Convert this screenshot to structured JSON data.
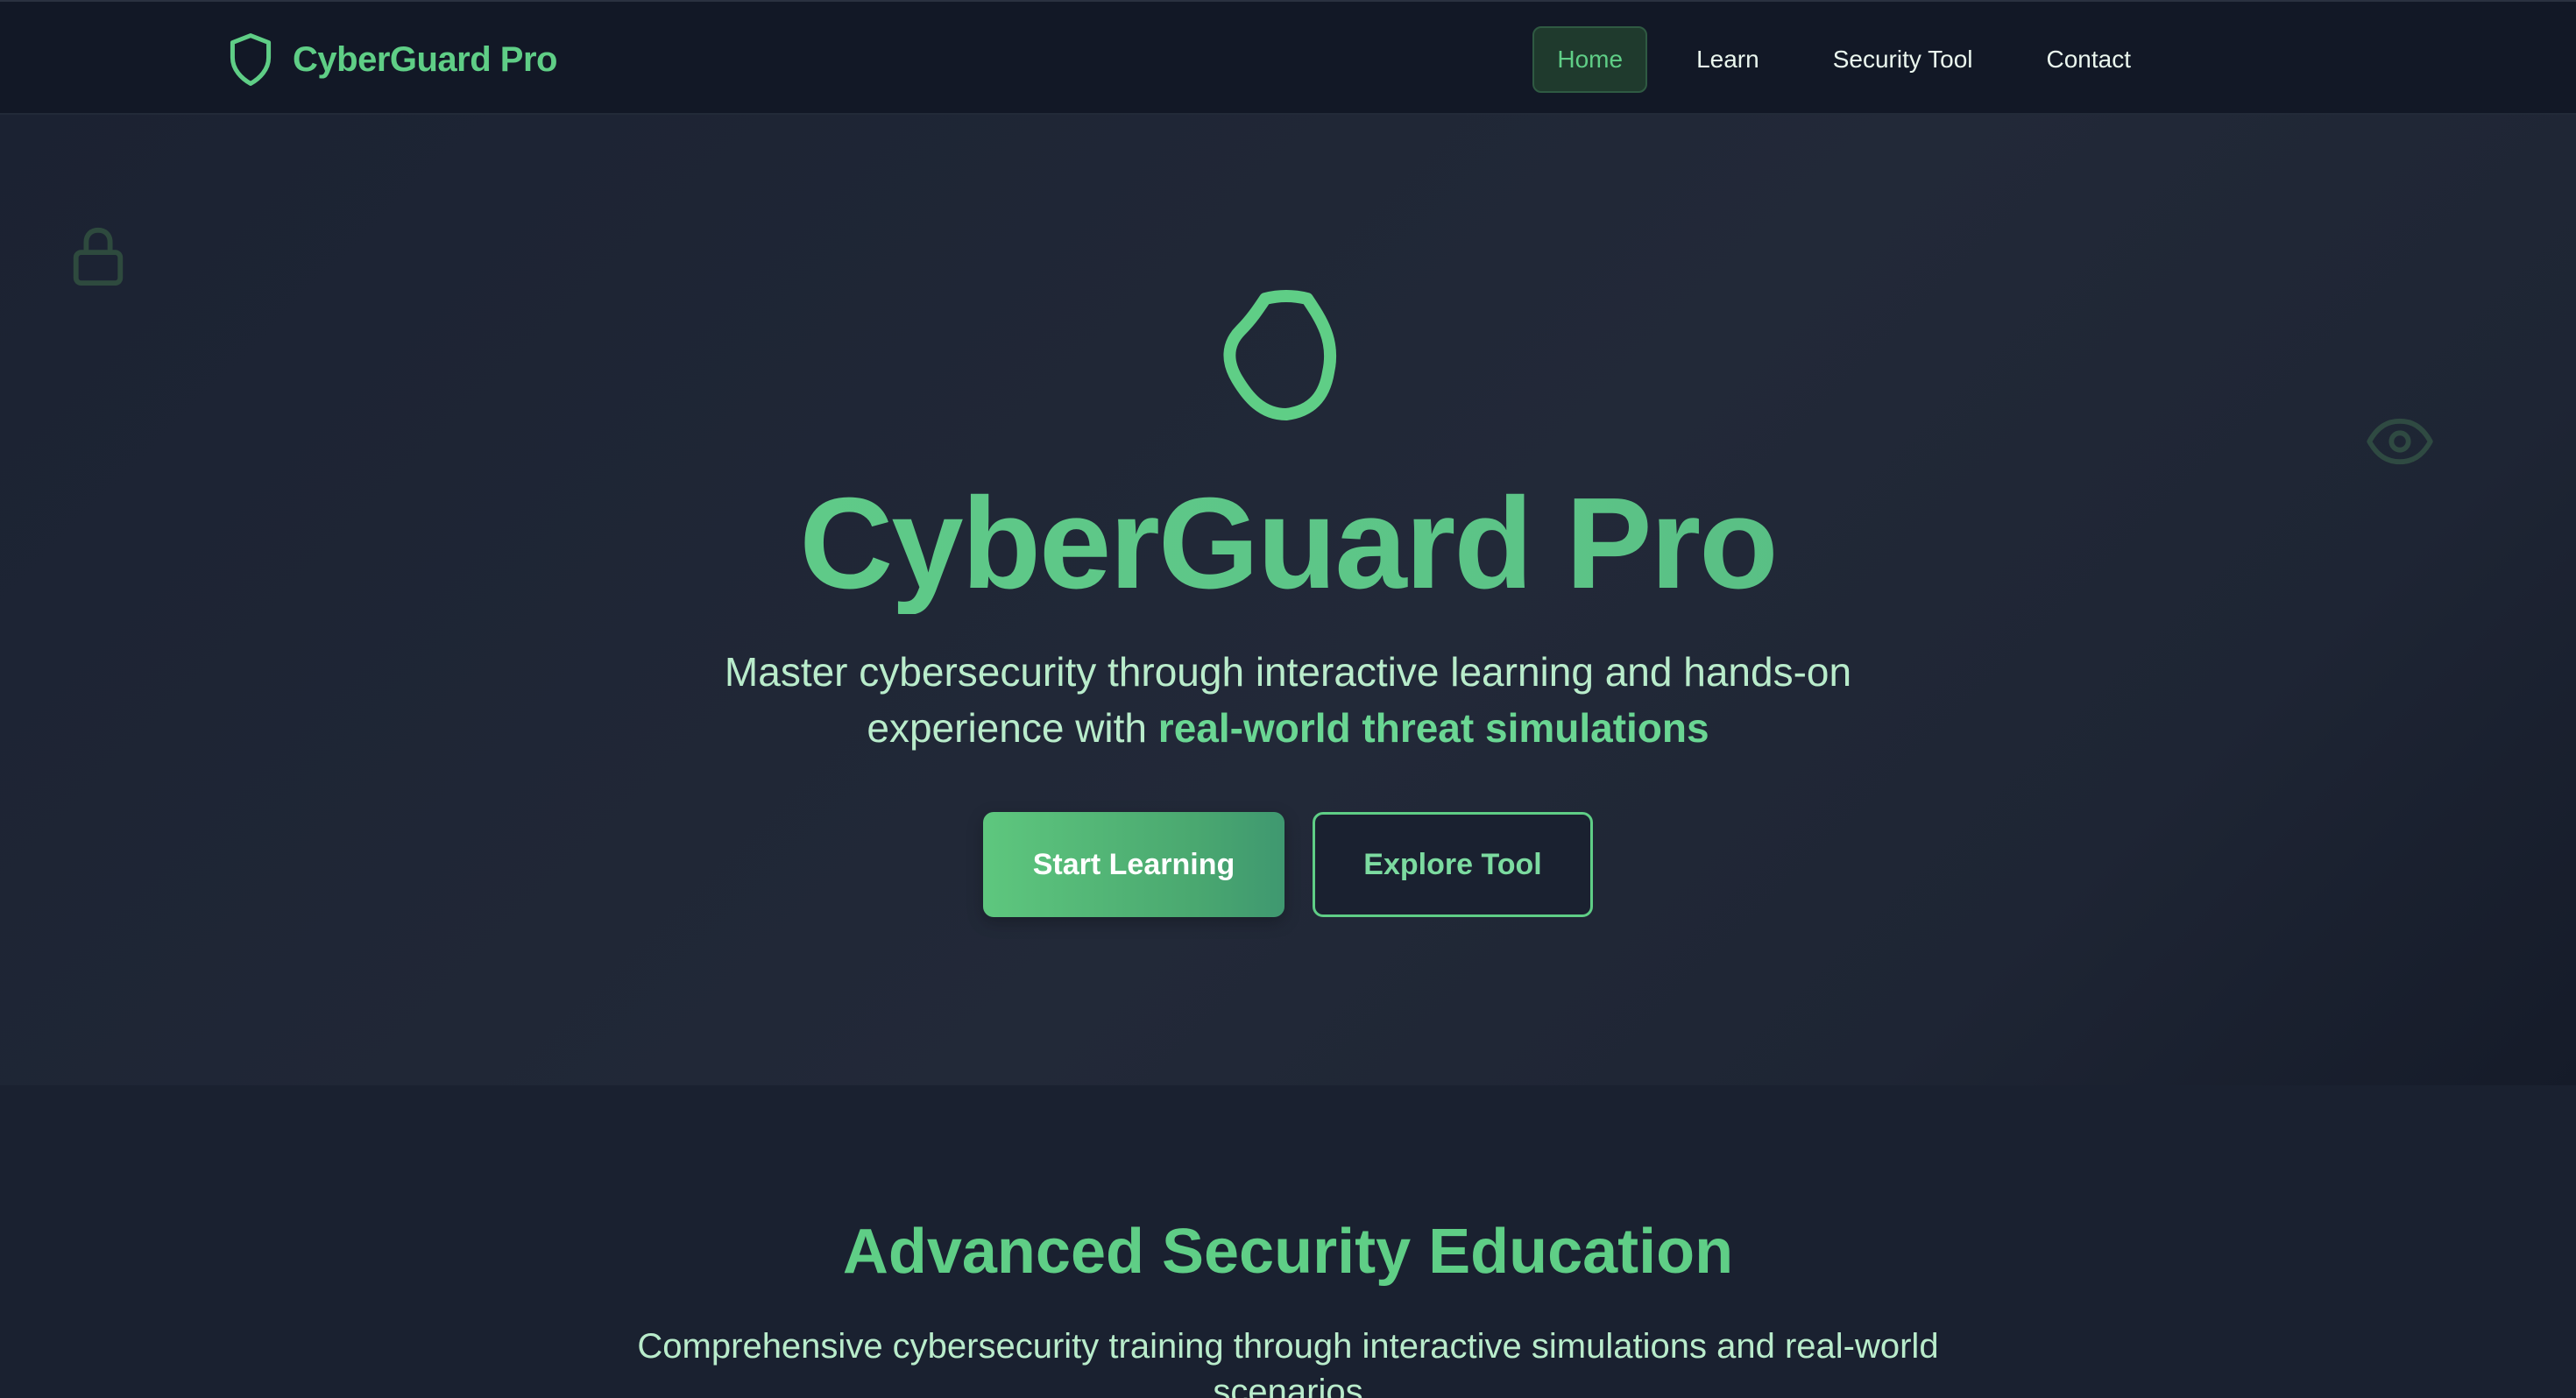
{
  "brand": {
    "name": "CyberGuard Pro",
    "icon": "shield-icon",
    "color": "#5fce86"
  },
  "nav": {
    "items": [
      {
        "label": "Home",
        "active": true
      },
      {
        "label": "Learn",
        "active": false
      },
      {
        "label": "Security Tool",
        "active": false
      },
      {
        "label": "Contact",
        "active": false
      }
    ]
  },
  "hero": {
    "icon": "shield-icon",
    "decorative_icons": [
      "lock-icon",
      "eye-icon"
    ],
    "title": "CyberGuard Pro",
    "subtitle_prefix": "Master cybersecurity through interactive learning and hands-on experience with ",
    "subtitle_emphasis": "real-world threat simulations",
    "primary_button": "Start Learning",
    "secondary_button": "Explore Tool"
  },
  "features": {
    "title": "Advanced Security Education",
    "subtitle": "Comprehensive cybersecurity training through interactive simulations and real-world scenarios"
  },
  "colors": {
    "accent": "#5fce86",
    "background": "#1a2130",
    "navbar": "#121826"
  }
}
